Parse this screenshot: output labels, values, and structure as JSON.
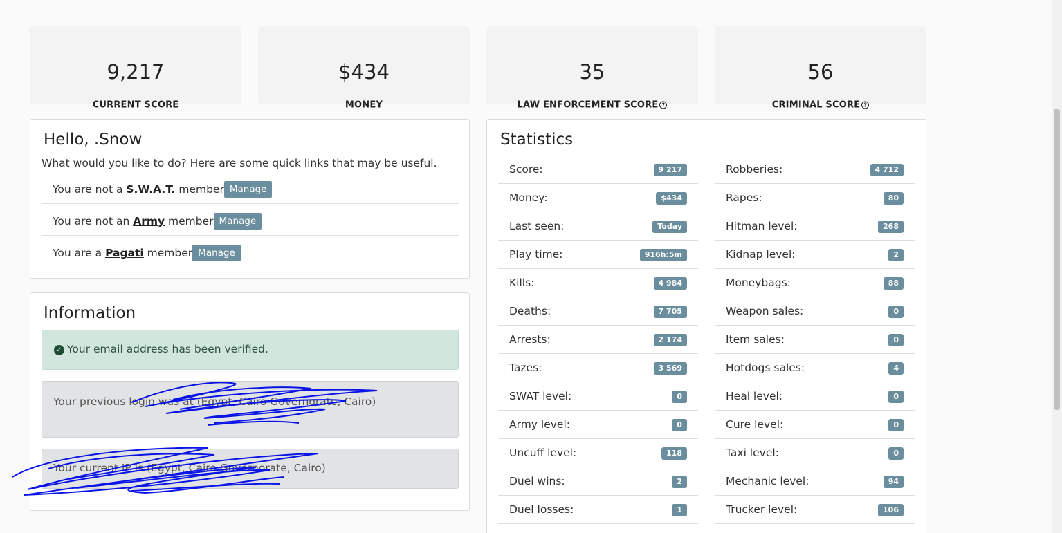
{
  "score_cards": [
    {
      "value": "9,217",
      "label": "CURRENT SCORE",
      "help": false
    },
    {
      "value": "$434",
      "label": "MONEY",
      "help": false
    },
    {
      "value": "35",
      "label": "LAW ENFORCEMENT SCORE",
      "help": true
    },
    {
      "value": "56",
      "label": "CRIMINAL SCORE",
      "help": true
    }
  ],
  "help_icon": "question-circle-icon",
  "hello": {
    "title": "Hello, .Snow",
    "intro": "What would you like to do? Here are some quick links that may be useful.",
    "memberships": [
      {
        "prefix": "You are not a ",
        "group": "S.W.A.T.",
        "suffix": " member",
        "button": "Manage"
      },
      {
        "prefix": "You are not an ",
        "group": "Army",
        "suffix": " member",
        "button": "Manage"
      },
      {
        "prefix": "You are a ",
        "group": "Pagati",
        "suffix": " member",
        "button": "Manage"
      }
    ]
  },
  "information": {
    "title": "Information",
    "verified": "Your email address has been verified.",
    "previous_login": "Your previous login was at (Egypt, Cairo Governorate, Cairo)",
    "current_ip": "Your current IP is (Egypt, Cairo Governorate, Cairo)"
  },
  "statistics": {
    "title": "Statistics",
    "left": [
      {
        "name": "Score:",
        "value": "9 217"
      },
      {
        "name": "Money:",
        "value": "$434"
      },
      {
        "name": "Last seen:",
        "value": "Today"
      },
      {
        "name": "Play time:",
        "value": "916h:5m"
      },
      {
        "name": "Kills:",
        "value": "4 984"
      },
      {
        "name": "Deaths:",
        "value": "7 705"
      },
      {
        "name": "Arrests:",
        "value": "2 174"
      },
      {
        "name": "Tazes:",
        "value": "3 569"
      },
      {
        "name": "SWAT level:",
        "value": "0"
      },
      {
        "name": "Army level:",
        "value": "0"
      },
      {
        "name": "Uncuff level:",
        "value": "118"
      },
      {
        "name": "Duel wins:",
        "value": "2"
      },
      {
        "name": "Duel losses:",
        "value": "1"
      }
    ],
    "right": [
      {
        "name": "Robberies:",
        "value": "4 712"
      },
      {
        "name": "Rapes:",
        "value": "80"
      },
      {
        "name": "Hitman level:",
        "value": "268"
      },
      {
        "name": "Kidnap level:",
        "value": "2"
      },
      {
        "name": "Moneybags:",
        "value": "88"
      },
      {
        "name": "Weapon sales:",
        "value": "0"
      },
      {
        "name": "Item sales:",
        "value": "0"
      },
      {
        "name": "Hotdogs sales:",
        "value": "4"
      },
      {
        "name": "Heal level:",
        "value": "0"
      },
      {
        "name": "Cure level:",
        "value": "0"
      },
      {
        "name": "Taxi level:",
        "value": "0"
      },
      {
        "name": "Mechanic level:",
        "value": "94"
      },
      {
        "name": "Trucker level:",
        "value": "106"
      }
    ]
  },
  "colors": {
    "badge": "#6b8e9e",
    "success_bg": "#d1e7dd",
    "scribble": "#0a14e6"
  }
}
